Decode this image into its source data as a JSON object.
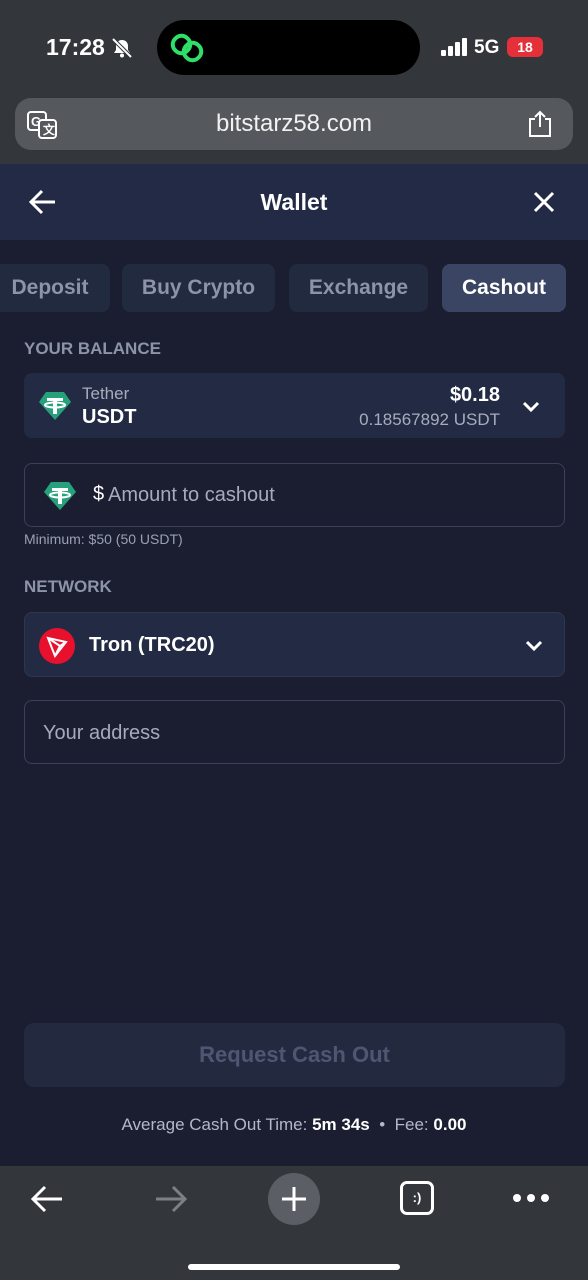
{
  "status": {
    "time": "17:28",
    "network": "5G",
    "battery": "18"
  },
  "browser": {
    "url": "bitstarz58.com"
  },
  "header": {
    "title": "Wallet"
  },
  "tabs": [
    {
      "label": "Deposit"
    },
    {
      "label": "Buy Crypto"
    },
    {
      "label": "Exchange"
    },
    {
      "label": "Cashout"
    }
  ],
  "balance": {
    "section_label": "YOUR BALANCE",
    "coin_name": "Tether",
    "coin_symbol": "USDT",
    "usd_value": "$0.18",
    "amount": "0.18567892 USDT"
  },
  "amount_field": {
    "currency_symbol": "$",
    "placeholder": "Amount to cashout",
    "minimum": "Minimum: $50 (50 USDT)"
  },
  "network": {
    "section_label": "NETWORK",
    "selected": "Tron (TRC20)"
  },
  "address_field": {
    "placeholder": "Your address"
  },
  "cta": {
    "label": "Request Cash Out"
  },
  "footer": {
    "avg_label": "Average Cash Out Time:",
    "avg_value": "5m 34s",
    "separator": "•",
    "fee_label": "Fee:",
    "fee_value": "0.00"
  },
  "bottom_bar": {
    "tabs_glyph": ":)"
  },
  "colors": {
    "background": "#1a1e30",
    "header": "#222a45",
    "tether": "#26a17b",
    "tron": "#e8112d",
    "active_tab": "#394563"
  }
}
